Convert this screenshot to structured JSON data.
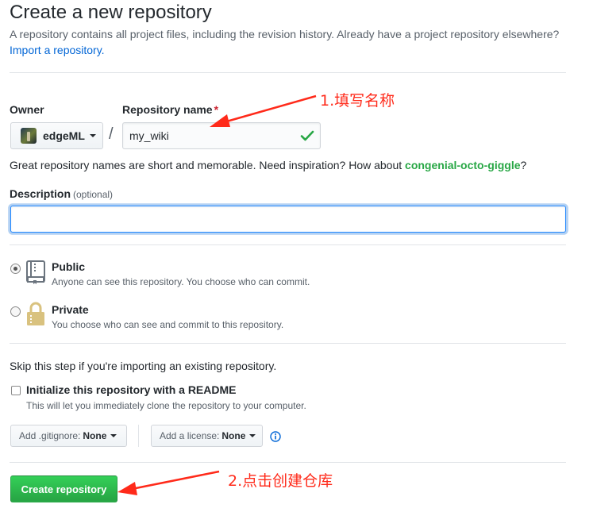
{
  "header": {
    "title": "Create a new repository",
    "subtitle": "A repository contains all project files, including the revision history. Already have a project repository elsewhere?",
    "import_link": "Import a repository."
  },
  "owner": {
    "label": "Owner",
    "value": "edgeML"
  },
  "repo_name": {
    "label": "Repository name",
    "required_mark": "*",
    "value": "my_wiki",
    "separator": "/"
  },
  "hint": {
    "text": "Great repository names are short and memorable. Need inspiration? How about",
    "suggestion": "congenial-octo-giggle",
    "end": "?"
  },
  "description": {
    "label": "Description",
    "optional": "(optional)",
    "value": ""
  },
  "visibility": {
    "public": {
      "title": "Public",
      "note": "Anyone can see this repository. You choose who can commit.",
      "selected": true
    },
    "private": {
      "title": "Private",
      "note": "You choose who can see and commit to this repository.",
      "selected": false
    }
  },
  "init": {
    "skip_text": "Skip this step if you're importing an existing repository.",
    "readme_label": "Initialize this repository with a README",
    "readme_note": "This will let you immediately clone the repository to your computer.",
    "readme_checked": false
  },
  "selects": {
    "gitignore_label": "Add .gitignore:",
    "gitignore_value": "None",
    "license_label": "Add a license:",
    "license_value": "None"
  },
  "submit": {
    "label": "Create repository"
  },
  "annotations": {
    "step1": "1.填写名称",
    "step2": "2.点击创建仓库",
    "color": "#ff2a1a"
  },
  "colors": {
    "link": "#0366d6",
    "success": "#28a745",
    "focus": "#2188ff"
  }
}
